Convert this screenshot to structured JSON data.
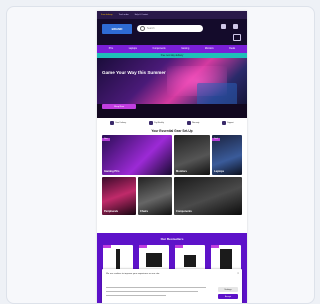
{
  "topbar": {
    "items": [
      "Free delivery",
      "Track order",
      "Help & Contact"
    ]
  },
  "header": {
    "logo_text": "BRAND",
    "search_placeholder": "Search"
  },
  "nav": {
    "items": [
      "PCs",
      "Laptops",
      "Components",
      "Gaming",
      "Monitors",
      "Deals"
    ]
  },
  "promo": {
    "text": "Free next day delivery"
  },
  "hero": {
    "headline": "Game Your Way this Summer",
    "button_label": "Shop Now"
  },
  "features": {
    "items": [
      "Free Delivery",
      "Pay Monthly",
      "Warranty",
      "Support"
    ]
  },
  "section": {
    "title": "Your Essential Gear Set-Up"
  },
  "tiles": [
    {
      "label": "Gaming PCs",
      "tag": "New"
    },
    {
      "label": "Monitors",
      "tag": ""
    },
    {
      "label": "Laptops",
      "tag": "Deal"
    },
    {
      "label": "Peripherals",
      "tag": ""
    },
    {
      "label": "Chairs",
      "tag": ""
    },
    {
      "label": "Components",
      "tag": ""
    }
  ],
  "bestsellers": {
    "title": "Our Bestsellers"
  },
  "cookie": {
    "text": "We use cookies to improve your experience on our site.",
    "accept_label": "Accept",
    "settings_label": "Settings",
    "close_glyph": "×"
  },
  "colors": {
    "nav_purple": "#7a1fd8",
    "header_dark": "#140b2b",
    "promo_teal": "#1ec0b8",
    "bestsellers_purple": "#5d12c9",
    "accent_pink": "#c13ee0"
  }
}
